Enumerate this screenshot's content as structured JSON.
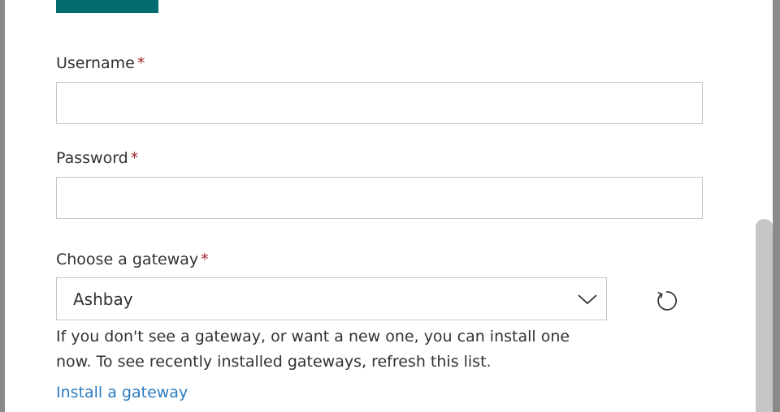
{
  "form": {
    "username": {
      "label": "Username",
      "required_mark": "*",
      "value": ""
    },
    "password": {
      "label": "Password",
      "required_mark": "*",
      "value": ""
    },
    "gateway": {
      "label": "Choose a gateway",
      "required_mark": "*",
      "selected": "Ashbay",
      "help_text": "If you don't see a gateway, or want a new one, you can install one now. To see recently installed gateways, refresh this list.",
      "install_link": "Install a gateway"
    }
  },
  "icons": {
    "dropdown": "chevron-down-icon",
    "refresh": "refresh-icon"
  },
  "colors": {
    "primary_button": "#036c70",
    "required": "#a4262c",
    "link": "#2b7bbf",
    "border": "#c8c6c4",
    "backdrop": "#8a8a8a"
  }
}
